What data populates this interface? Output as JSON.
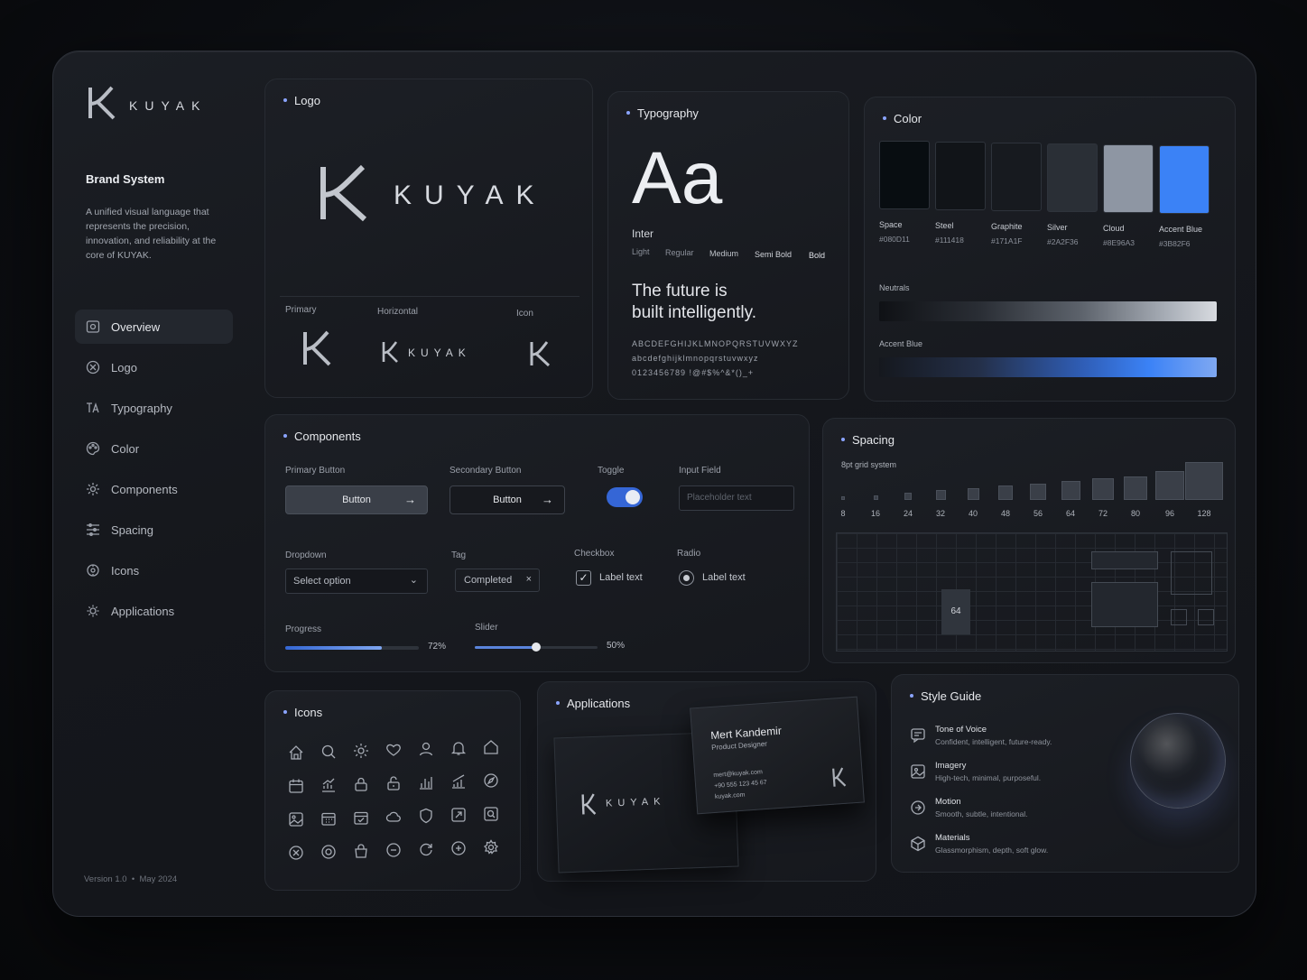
{
  "brand": {
    "wordmark": "KUYAK",
    "title": "Brand System",
    "description": "A unified visual language that represents the precision, innovation, and reliability at the core of KUYAK.",
    "version": "Version 1.0",
    "date": "May 2024"
  },
  "nav": [
    {
      "label": "Overview",
      "icon": "overview-icon"
    },
    {
      "label": "Logo",
      "icon": "logo-icon"
    },
    {
      "label": "Typography",
      "icon": "typography-icon"
    },
    {
      "label": "Color",
      "icon": "palette-icon"
    },
    {
      "label": "Components",
      "icon": "components-icon"
    },
    {
      "label": "Spacing",
      "icon": "spacing-icon"
    },
    {
      "label": "Icons",
      "icon": "icons-icon"
    },
    {
      "label": "Applications",
      "icon": "applications-icon"
    }
  ],
  "logo": {
    "title": "Logo",
    "variants": [
      "Primary",
      "Horizontal",
      "Icon"
    ]
  },
  "typography": {
    "title": "Typography",
    "sample": "Aa",
    "font": "Inter",
    "weights": [
      "Light",
      "Regular",
      "Medium",
      "Semi Bold",
      "Bold"
    ],
    "headline_1": "The future is",
    "headline_2": "built intelligently.",
    "upper": "ABCDEFGHIJKLMNOPQRSTUVWXYZ",
    "lower": "abcdefghijklmnopqrstuvwxyz",
    "digits": "0123456789  !@#$%^&*()_+"
  },
  "color": {
    "title": "Color",
    "swatches": [
      {
        "name": "Space",
        "hex": "#080D11"
      },
      {
        "name": "Steel",
        "hex": "#111418"
      },
      {
        "name": "Graphite",
        "hex": "#171A1F"
      },
      {
        "name": "Silver",
        "hex": "#2A2F36"
      },
      {
        "name": "Cloud",
        "hex": "#8E96A3"
      },
      {
        "name": "Accent Blue",
        "hex": "#3B82F6"
      }
    ],
    "neutrals_label": "Neutrals",
    "accent_label": "Accent Blue"
  },
  "components": {
    "title": "Components",
    "primary_label": "Primary Button",
    "primary_btn": "Button",
    "secondary_label": "Secondary Button",
    "secondary_btn": "Button",
    "toggle_label": "Toggle",
    "input_label": "Input Field",
    "input_placeholder": "Placeholder text",
    "dropdown_label": "Dropdown",
    "dropdown_value": "Select option",
    "tag_label": "Tag",
    "tag_value": "Completed",
    "checkbox_label": "Checkbox",
    "checkbox_text": "Label text",
    "radio_label": "Radio",
    "radio_text": "Label text",
    "progress_label": "Progress",
    "progress_value": "72%",
    "progress_fraction": 0.72,
    "slider_label": "Slider",
    "slider_value": "50%",
    "slider_fraction": 0.5
  },
  "spacing": {
    "title": "Spacing",
    "subtitle": "8pt grid system",
    "steps": [
      "8",
      "16",
      "24",
      "32",
      "40",
      "48",
      "56",
      "64",
      "72",
      "80",
      "96",
      "128"
    ],
    "grid_label": "64"
  },
  "icons": {
    "title": "Icons",
    "names": [
      "home-icon",
      "search-icon",
      "gear-icon",
      "heart-icon",
      "user-icon",
      "bell-icon",
      "house-icon",
      "calendar-icon",
      "chart-icon",
      "lock-icon",
      "lock-open-icon",
      "bar-chart-icon",
      "growth-chart-icon",
      "compass-icon",
      "image-icon",
      "calendar-grid-icon",
      "calendar-check-icon",
      "cloud-icon",
      "shield-icon",
      "expand-icon",
      "zoom-icon",
      "close-circle-icon",
      "target-icon",
      "bag-icon",
      "minus-circle-icon",
      "refresh-icon",
      "plus-circle-icon",
      "settings-icon"
    ]
  },
  "applications": {
    "title": "Applications",
    "card_name": "Mert Kandemir",
    "card_role": "Product Designer",
    "card_email": "mert@kuyak.com",
    "card_phone": "+90 555 123 45 67",
    "card_web": "kuyak.com"
  },
  "style_guide": {
    "title": "Style Guide",
    "items": [
      {
        "title": "Tone of Voice",
        "desc": "Confident, intelligent, future-ready."
      },
      {
        "title": "Imagery",
        "desc": "High-tech, minimal, purposeful."
      },
      {
        "title": "Motion",
        "desc": "Smooth, subtle, intentional."
      },
      {
        "title": "Materials",
        "desc": "Glassmorphism, depth, soft glow."
      }
    ]
  }
}
